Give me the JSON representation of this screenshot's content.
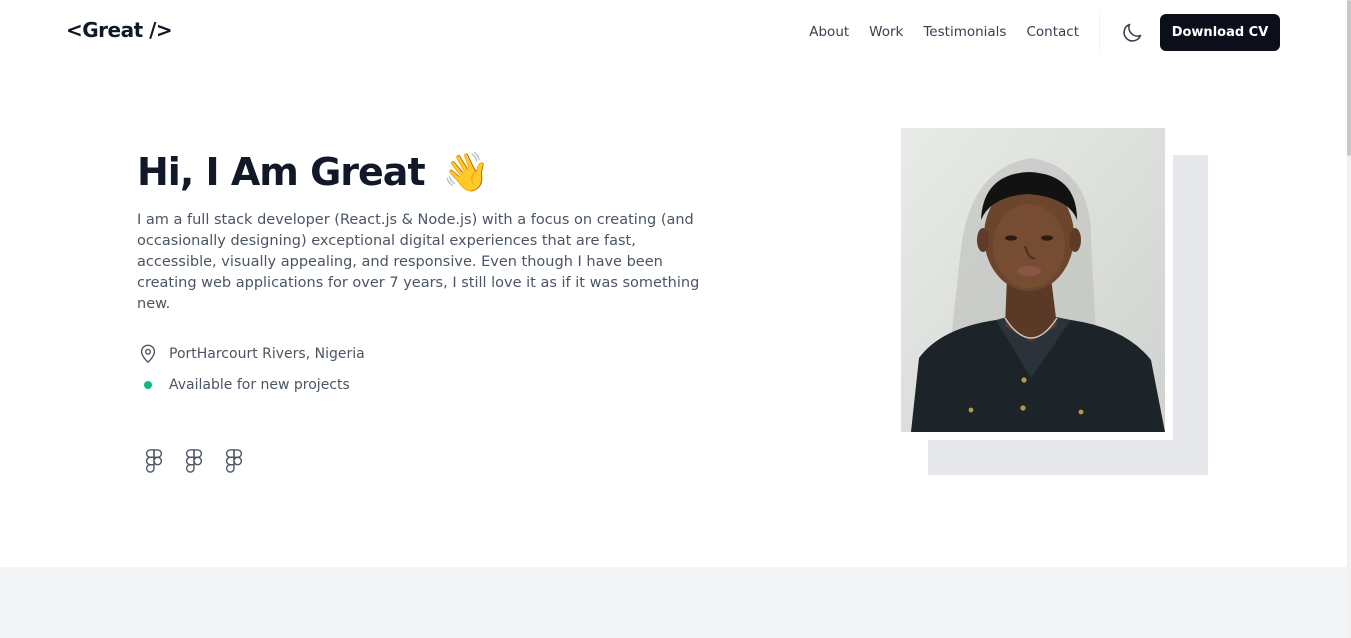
{
  "header": {
    "logo": "<Great />",
    "nav": [
      "About",
      "Work",
      "Testimonials",
      "Contact"
    ],
    "theme_icon": "moon-icon",
    "download_label": "Download CV"
  },
  "hero": {
    "title": "Hi, I Am Great",
    "wave_emoji": "👋",
    "description": "I am a full stack developer (React.js & Node.js) with a focus on creating (and occasionally designing) exceptional digital experiences that are fast, accessible, visually appealing, and responsive. Even though I have been creating web applications for over 7 years, I still love it as if it was something new.",
    "location": "PortHarcourt Rivers, Nigeria",
    "availability": "Available for new projects",
    "status_color": "#10b981",
    "socials": [
      "figma-icon",
      "figma-icon",
      "figma-icon"
    ]
  },
  "colors": {
    "primary_button": "#0b0f19",
    "text_dark": "#111827",
    "text_muted": "#4b5563",
    "photo_shadow": "#e5e7eb",
    "section_band": "#f3f4f6"
  }
}
